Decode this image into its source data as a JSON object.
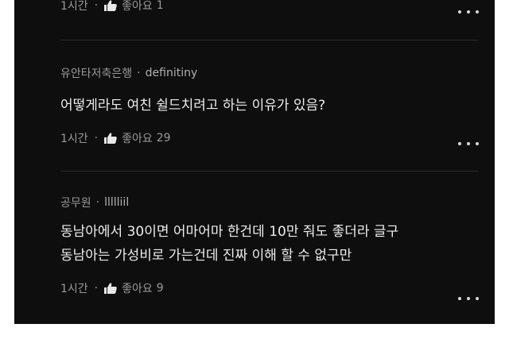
{
  "comments": [
    {
      "time": "1시간",
      "like_label": "좋아요",
      "like_count": "1"
    },
    {
      "author": "유안타저축은행",
      "handle": "definitiny",
      "text": "어떻게라도 여친 쉴드치려고 하는 이유가 있음?",
      "time": "1시간",
      "like_label": "좋아요",
      "like_count": "29"
    },
    {
      "author": "공무원",
      "handle": "llllliil",
      "text": "동남아에서 30이면 어마어마 한건데 10만 줘도 좋더라 글구\n동남아는 가성비로 가는건데 진짜 이해 할 수 없구만",
      "time": "1시간",
      "like_label": "좋아요",
      "like_count": "9"
    }
  ],
  "separator": "·",
  "icons": {
    "like": "thumbs-up-icon",
    "more": "more-dots-icon"
  },
  "colors": {
    "background": "#0e0e0e",
    "text": "#ededed",
    "muted": "#9a9a9a"
  }
}
